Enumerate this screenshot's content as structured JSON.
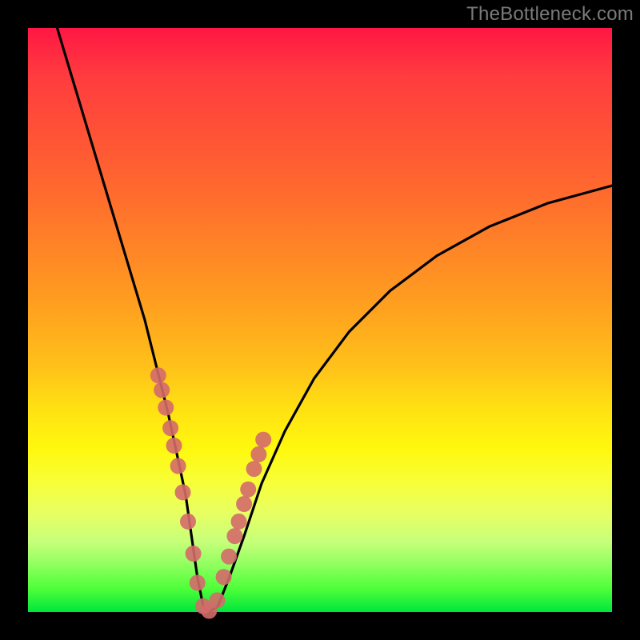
{
  "watermark": "TheBottleneck.com",
  "chart_data": {
    "type": "line",
    "title": "",
    "xlabel": "",
    "ylabel": "",
    "xlim": [
      0,
      100
    ],
    "ylim": [
      0,
      100
    ],
    "series": [
      {
        "name": "bottleneck-curve",
        "x": [
          5,
          8,
          11,
          14,
          17,
          20,
          22,
          24,
          25.5,
          27,
          28,
          29,
          30,
          31,
          32.5,
          34.5,
          37,
          40,
          44,
          49,
          55,
          62,
          70,
          79,
          89,
          100
        ],
        "y": [
          100,
          90,
          80,
          70,
          60,
          50,
          42,
          34,
          27,
          20,
          13,
          6,
          1,
          0,
          1,
          6,
          13,
          22,
          31,
          40,
          48,
          55,
          61,
          66,
          70,
          73
        ]
      }
    ],
    "markers": {
      "name": "highlight-points",
      "x": [
        22.3,
        22.9,
        23.6,
        24.4,
        25.0,
        25.7,
        26.5,
        27.4,
        28.3,
        29.0,
        30.0,
        31.0,
        32.4,
        33.5,
        34.4,
        35.4,
        36.1,
        37.0,
        37.7,
        38.7,
        39.5,
        40.3
      ],
      "y": [
        40.5,
        38.0,
        35.0,
        31.5,
        28.5,
        25.0,
        20.5,
        15.5,
        10.0,
        5.0,
        1.0,
        0.2,
        2.0,
        6.0,
        9.5,
        13.0,
        15.5,
        18.5,
        21.0,
        24.5,
        27.0,
        29.5
      ]
    },
    "background_gradient": {
      "top": "#ff1744",
      "upper_mid": "#ff8526",
      "mid": "#ffe013",
      "lower_mid": "#c6ff7a",
      "bottom": "#00e63b"
    },
    "marker_color": "#d46a6a",
    "curve_color": "#000000"
  }
}
